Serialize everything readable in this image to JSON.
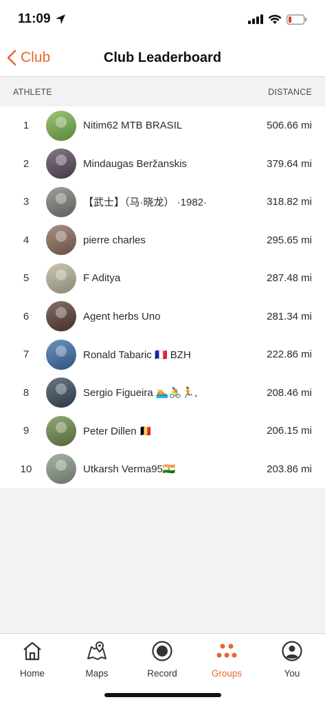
{
  "status_bar": {
    "time": "11:09"
  },
  "header": {
    "back_label": "Club",
    "title": "Club Leaderboard"
  },
  "columns": {
    "athlete": "ATHLETE",
    "distance": "DISTANCE"
  },
  "athletes": [
    {
      "rank": "1",
      "name": "Nitim62 MTB BRASIL",
      "distance": "506.66 mi",
      "avatar_color": "#7bb24a"
    },
    {
      "rank": "2",
      "name": "Mindaugas Beržanskis",
      "distance": "379.64 mi",
      "avatar_color": "#5a4a5e"
    },
    {
      "rank": "3",
      "name": "【武士】（马·晓龙） ·1982·",
      "distance": "318.82 mi",
      "avatar_color": "#7d7d78"
    },
    {
      "rank": "4",
      "name": "pierre charles",
      "distance": "295.65 mi",
      "avatar_color": "#8a6a58"
    },
    {
      "rank": "5",
      "name": "F Aditya",
      "distance": "287.48 mi",
      "avatar_color": "#b9b49a"
    },
    {
      "rank": "6",
      "name": "Agent herbs Uno",
      "distance": "281.34 mi",
      "avatar_color": "#5c3e36"
    },
    {
      "rank": "7",
      "name": "Ronald Tabaric 🇫🇷 BZH",
      "distance": "222.86 mi",
      "avatar_color": "#3d6fa8"
    },
    {
      "rank": "8",
      "name": "Sergio Figueira 🏊🚴🏃,",
      "distance": "208.46 mi",
      "avatar_color": "#3b4a5c"
    },
    {
      "rank": "9",
      "name": "Peter Dillen 🇧🇪",
      "distance": "206.15 mi",
      "avatar_color": "#6e8a4a"
    },
    {
      "rank": "10",
      "name": "Utkarsh Verma95🇮🇳",
      "distance": "203.86 mi",
      "avatar_color": "#8a9a8a"
    }
  ],
  "tabs": [
    {
      "label": "Home",
      "icon": "home-icon",
      "active": false
    },
    {
      "label": "Maps",
      "icon": "map-icon",
      "active": false
    },
    {
      "label": "Record",
      "icon": "record-icon",
      "active": false
    },
    {
      "label": "Groups",
      "icon": "groups-icon",
      "active": true
    },
    {
      "label": "You",
      "icon": "profile-icon",
      "active": false
    }
  ],
  "colors": {
    "accent": "#e8652e",
    "background": "#f2f2f3"
  }
}
